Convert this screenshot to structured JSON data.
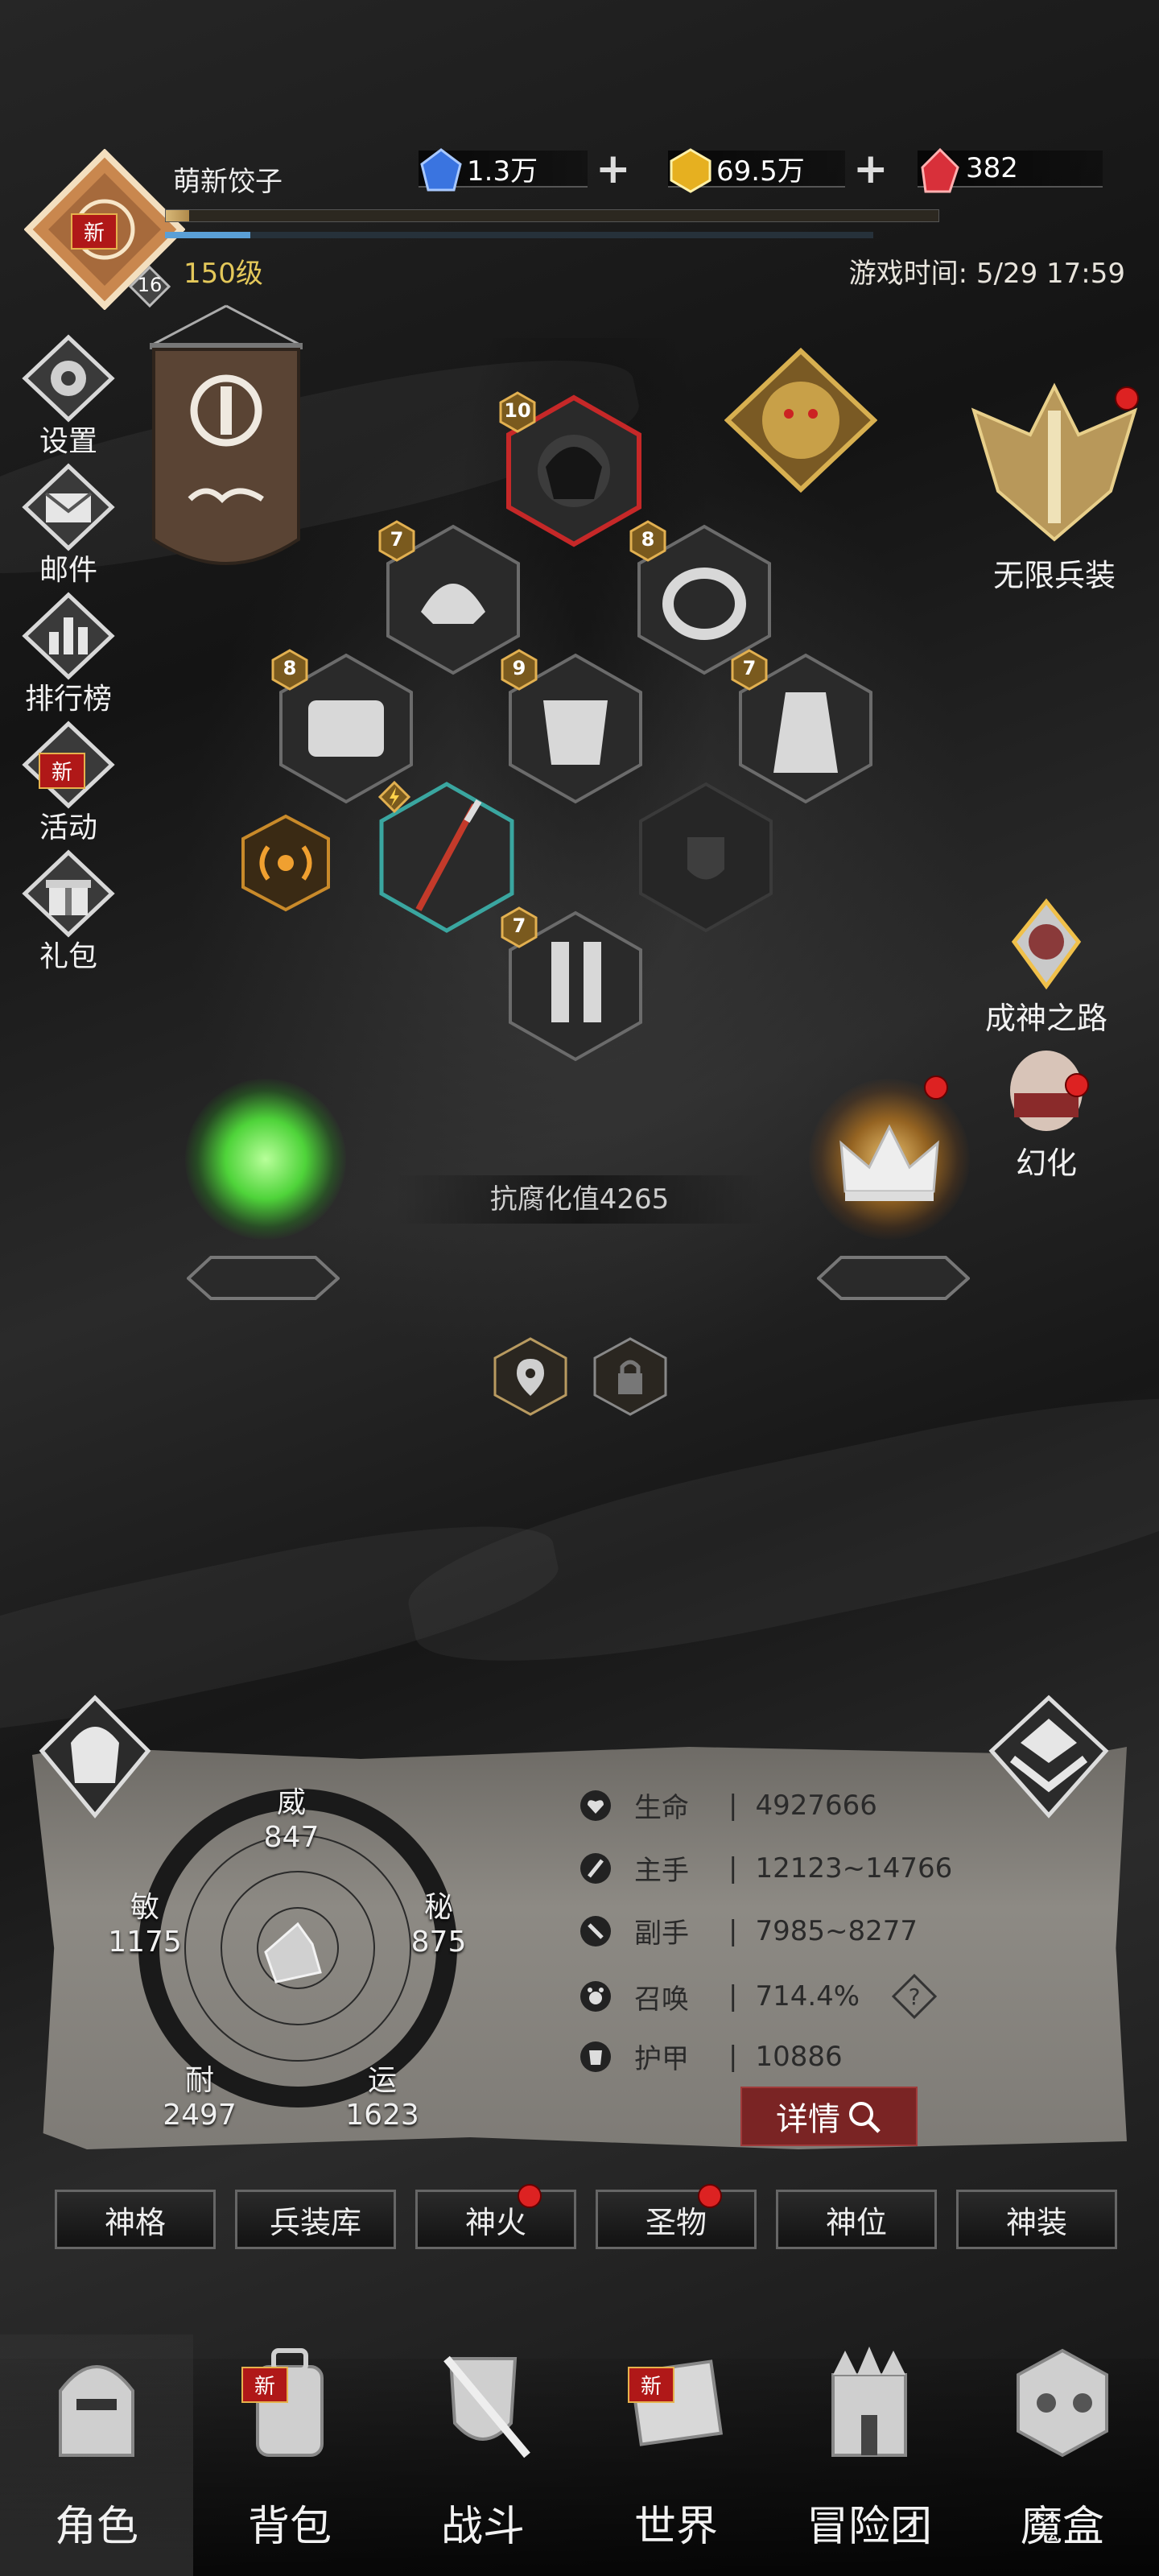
{
  "player": {
    "name": "萌新饺子",
    "level": "150级",
    "rank_badge": "16",
    "avatar_new": "新",
    "xp_fraction": 0.03,
    "bar2_fraction": 0.12
  },
  "resources": [
    {
      "icon": "blue-crystal-icon",
      "value": "1.3万",
      "color": "#3a74e0"
    },
    {
      "icon": "gold-crystal-icon",
      "value": "69.5万",
      "color": "#e6b020"
    },
    {
      "icon": "red-crystal-icon",
      "value": "382",
      "color": "#d8303a"
    }
  ],
  "playtime": "游戏时间: 5/29 17:59",
  "left_menu": [
    {
      "label": "设置",
      "icon": "gear-icon"
    },
    {
      "label": "邮件",
      "icon": "mail-icon"
    },
    {
      "label": "排行榜",
      "icon": "leaderboard-icon"
    },
    {
      "label": "活动",
      "icon": "event-icon",
      "badge": "新"
    },
    {
      "label": "礼包",
      "icon": "gift-icon"
    }
  ],
  "right_menu": {
    "infinite_weapon": "无限兵装",
    "god_path": "成神之路",
    "transform": "幻化"
  },
  "equipment": {
    "helmet_level": "10",
    "shoulder_level": "7",
    "ring_level": "8",
    "belt_level": "8",
    "armor_level": "9",
    "cloak_level": "7",
    "boots_level": "7"
  },
  "corruption": "抗腐化值4265",
  "attributes": {
    "wei": {
      "label": "威",
      "value": "847"
    },
    "mi": {
      "label": "秘",
      "value": "875"
    },
    "yun": {
      "label": "运",
      "value": "1623"
    },
    "nai": {
      "label": "耐",
      "value": "2497"
    },
    "min": {
      "label": "敏",
      "value": "1175"
    }
  },
  "stats": [
    {
      "label": "生命",
      "value": "4927666",
      "icon": "heart-icon"
    },
    {
      "label": "主手",
      "value": "12123~14766",
      "icon": "main-weapon-icon"
    },
    {
      "label": "副手",
      "value": "7985~8277",
      "icon": "off-weapon-icon"
    },
    {
      "label": "召唤",
      "value": "714.4%",
      "icon": "summon-icon"
    },
    {
      "label": "护甲",
      "value": "10886",
      "icon": "armor-icon"
    }
  ],
  "details_button": "详情",
  "help_mark": "?",
  "tabs": [
    "神格",
    "兵装库",
    "神火",
    "圣物",
    "神位",
    "神装"
  ],
  "bottom_nav": [
    {
      "label": "角色",
      "icon": "character-icon"
    },
    {
      "label": "背包",
      "icon": "backpack-icon",
      "badge": "新"
    },
    {
      "label": "战斗",
      "icon": "battle-icon"
    },
    {
      "label": "世界",
      "icon": "world-icon",
      "badge": "新"
    },
    {
      "label": "冒险团",
      "icon": "guild-icon"
    },
    {
      "label": "魔盒",
      "icon": "magic-box-icon"
    }
  ],
  "colors": {
    "gold": "#e4c85a",
    "new_red": "#b01818",
    "dot_red": "#dd2222"
  }
}
